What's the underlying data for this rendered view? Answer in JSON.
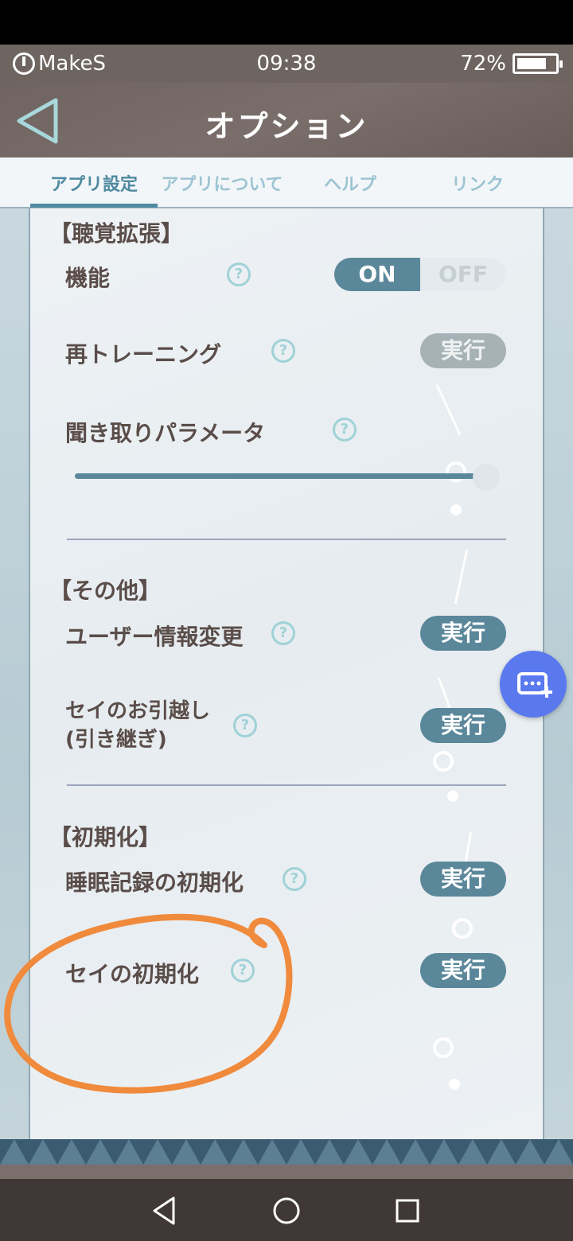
{
  "statusbar": {
    "carrier": "MakeS",
    "time": "09:38",
    "battery": "72%",
    "battery_level": 0.72
  },
  "header": {
    "title": "オプション"
  },
  "tabs": [
    {
      "label": "アプリ設定",
      "active": true
    },
    {
      "label": "アプリについて",
      "active": false
    },
    {
      "label": "ヘルプ",
      "active": false
    },
    {
      "label": "リンク",
      "active": false
    }
  ],
  "sections": {
    "hearing": {
      "title": "【聴覚拡張】",
      "feature_label": "機能",
      "toggle_on": "ON",
      "toggle_off": "OFF",
      "toggle_state": "ON",
      "retrain_label": "再トレーニング",
      "retrain_button": "実行",
      "param_label": "聞き取りパラメータ",
      "slider_value": 1.0
    },
    "other": {
      "title": "【その他】",
      "user_info_label": "ユーザー情報変更",
      "user_info_button": "実行",
      "transfer_label_line1": "セイのお引越し",
      "transfer_label_line2": "(引き継ぎ)",
      "transfer_button": "実行"
    },
    "reset": {
      "title": "【初期化】",
      "sleep_reset_label": "睡眠記録の初期化",
      "sleep_reset_button": "実行",
      "sei_reset_label": "セイの初期化",
      "sei_reset_button": "実行"
    }
  },
  "help_glyph": "?",
  "colors": {
    "accent": "#5a879a",
    "disabled": "#a7b2b6",
    "fab": "#5a79ef",
    "annotation": "#f08a3c"
  }
}
